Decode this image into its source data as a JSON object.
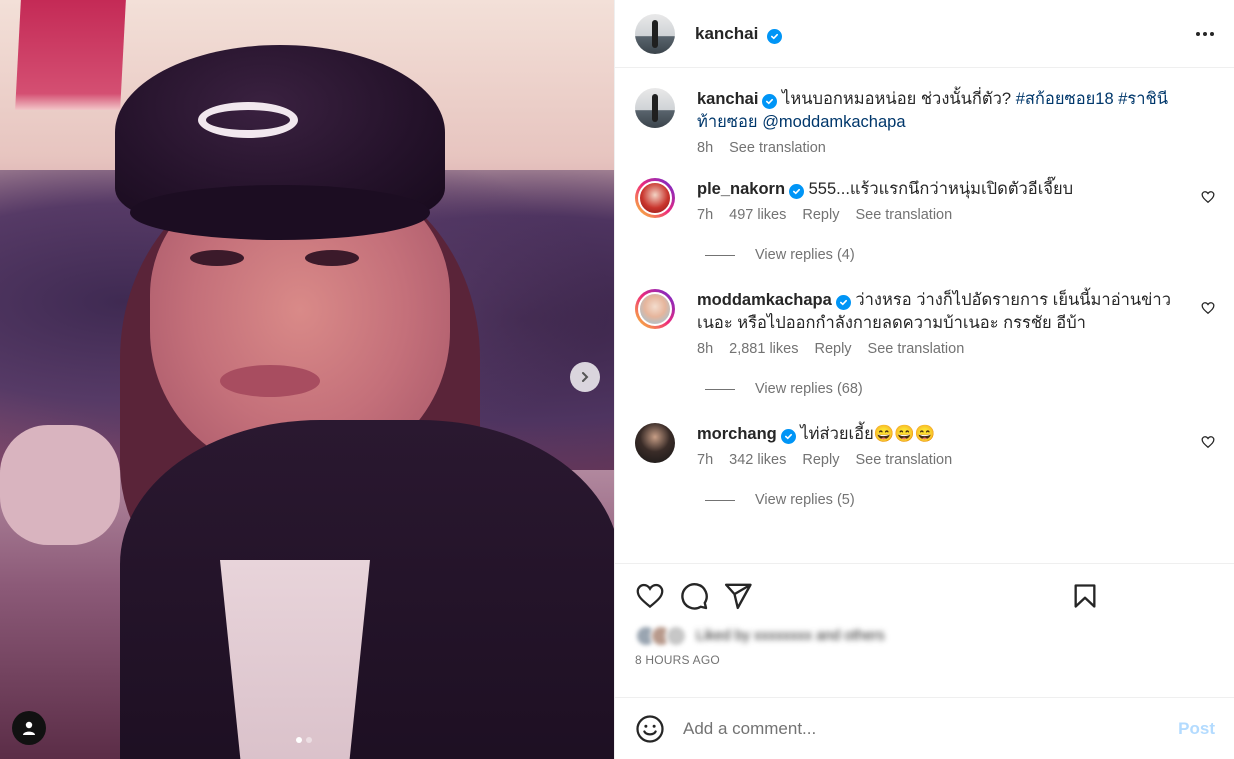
{
  "post": {
    "author": "kanchai",
    "caption": {
      "text": "ไหนบอกหมอหน่อย ช่วงนั้นกี่ตัว?",
      "hashtags": [
        "#สก้อยซอย18",
        "#ราชินีท้ายซอย"
      ],
      "mention": "@moddamkachapa",
      "time": "8h",
      "translate": "See translation"
    },
    "image_dots": 2,
    "timestamp": "8 HOURS AGO",
    "liked_by_text": "Liked by xxxxxxxx and others"
  },
  "comments": [
    {
      "username": "ple_nakorn",
      "text": "555...แร้วแรกนึกว่าหนุ่มเปิดตัวอีเจี๊ยบ",
      "time": "7h",
      "likes": "497 likes",
      "reply": "Reply",
      "translate": "See translation",
      "view_replies": "View replies (4)"
    },
    {
      "username": "moddamkachapa",
      "text": "ว่างหรอ ว่างก็ไปอัดรายการ เย็นนี้มาอ่านข่าวเนอะ หรือไปออกกำลังกายลดความบ้าเนอะ กรรชัย อีบ้า",
      "time": "8h",
      "likes": "2,881 likes",
      "reply": "Reply",
      "translate": "See translation",
      "view_replies": "View replies (68)"
    },
    {
      "username": "morchang",
      "text": "ไท่ส่วยเอี้ย😄😄😄",
      "time": "7h",
      "likes": "342 likes",
      "reply": "Reply",
      "translate": "See translation",
      "view_replies": "View replies (5)"
    }
  ],
  "add_comment": {
    "placeholder": "Add a comment...",
    "post_label": "Post"
  },
  "icons": {
    "like": "heart-icon",
    "comment": "comment-icon",
    "share": "paper-plane-icon",
    "save": "bookmark-icon",
    "more": "more-horizontal-icon",
    "emoji": "emoji-icon",
    "next": "chevron-right-icon",
    "tags": "user-tag-icon"
  },
  "colors": {
    "verified": "#0095f6",
    "hashtag": "#00376b",
    "post_button": "#b3dbff",
    "secondary_text": "#737373"
  }
}
